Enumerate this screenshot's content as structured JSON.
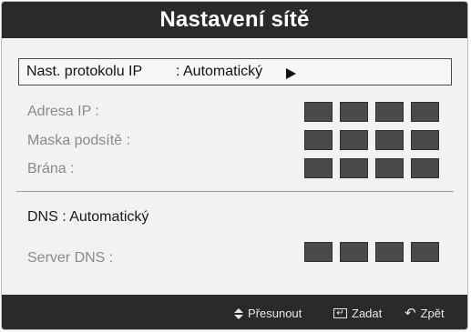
{
  "title": "Nastavení sítě",
  "protocol": {
    "label": "Nast. protokolu IP",
    "value": ": Automatický",
    "arrow_icon": "right-triangle-icon"
  },
  "fields": {
    "ip_address": "Adresa IP  :",
    "subnet_mask": "Maska podsítě  :",
    "gateway": "Brána  :",
    "dns": "DNS   : Automatický",
    "dns_server": "Server DNS  :"
  },
  "footer": {
    "move": "Přesunout",
    "enter": "Zadat",
    "back": "Zpět",
    "move_icon": "up-down-arrows-icon",
    "enter_icon": "enter-key-icon",
    "back_icon": "return-arrow-icon"
  },
  "colors": {
    "bar_background": "#2a2a2a",
    "content_background": "#f2f2f2",
    "block_fill": "#4a4a4a",
    "disabled_text": "#8a8a8a"
  }
}
